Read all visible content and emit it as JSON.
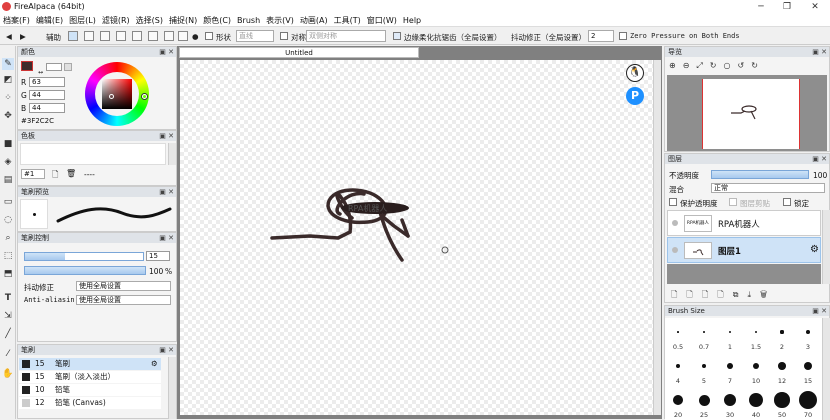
{
  "window": {
    "title": "FireAlpaca (64bit)",
    "minimize": "─",
    "maximize": "❐",
    "close": "✕"
  },
  "menu": [
    "档案(F)",
    "编辑(E)",
    "图层(L)",
    "滤镜(R)",
    "选择(S)",
    "捕捉(N)",
    "颜色(C)",
    "Brush",
    "表示(V)",
    "动画(A)",
    "工具(T)",
    "窗口(W)",
    "Help"
  ],
  "toolbar": {
    "assist_label": "辅助",
    "shape_label": "形状",
    "shape_value": "直线",
    "symmetry_label": "对称",
    "symmetry_value": "双侧对称",
    "edge_soften_label": "边缘柔化抗锯齿（全局设置）",
    "stabilizer_label": "抖动修正（全局设置）",
    "stabilizer_value": "2",
    "zero_pressure_label": "Zero Pressure on Both Ends"
  },
  "color_panel": {
    "title": "颜色",
    "r_label": "R",
    "r_value": "63",
    "g_label": "G",
    "g_value": "44",
    "b_label": "B",
    "b_value": "44",
    "hex": "#3F2C2C",
    "current_color": "#3f2c2c"
  },
  "swatch_panel": {
    "title": "色板",
    "index": "#1",
    "dash": "----"
  },
  "brush_preview_panel": {
    "title": "笔刷预览"
  },
  "brush_control_panel": {
    "title": "笔刷控制",
    "size_value": "15",
    "opacity_value": "100",
    "opacity_unit": "%",
    "opacity_fraction": 1.0,
    "stabilizer_label": "抖动修正",
    "stabilizer_value": "使用全局设置",
    "antialias_label": "Anti-aliasin",
    "antialias_value": "使用全局设置"
  },
  "brush_panel": {
    "title": "笔刷",
    "items": [
      {
        "size": "15",
        "name": "笔刷",
        "selected": true
      },
      {
        "size": "15",
        "name": "笔刷（淡入淡出）",
        "selected": false
      },
      {
        "size": "10",
        "name": "铅笔",
        "selected": false
      },
      {
        "size": "12",
        "name": "铅笔 (Canvas)",
        "selected": false
      }
    ]
  },
  "canvas": {
    "tab_title": "Untitled",
    "stroke_color": "#3a2a2a",
    "sketch_text": "RPA机器人"
  },
  "navigator": {
    "title": "导览"
  },
  "layers_panel": {
    "title": "图层",
    "opacity_label": "不透明度",
    "opacity_value": "100",
    "opacity_fraction": 1.0,
    "blend_label": "混合",
    "blend_value": "正常",
    "protect_alpha_label": "保护透明度",
    "clipping_label": "图层剪贴",
    "lock_label": "锁定",
    "layers": [
      {
        "name": "RPA机器人",
        "thumb_text": "RPA机器人",
        "selected": false
      },
      {
        "name": "图层1",
        "selected": true
      }
    ]
  },
  "brush_size_panel": {
    "title": "Brush Size",
    "sizes": [
      "0.5",
      "0.7",
      "1",
      "1.5",
      "2",
      "3",
      "4",
      "5",
      "7",
      "10",
      "12",
      "15",
      "20",
      "25",
      "30",
      "40",
      "50",
      "70"
    ]
  }
}
